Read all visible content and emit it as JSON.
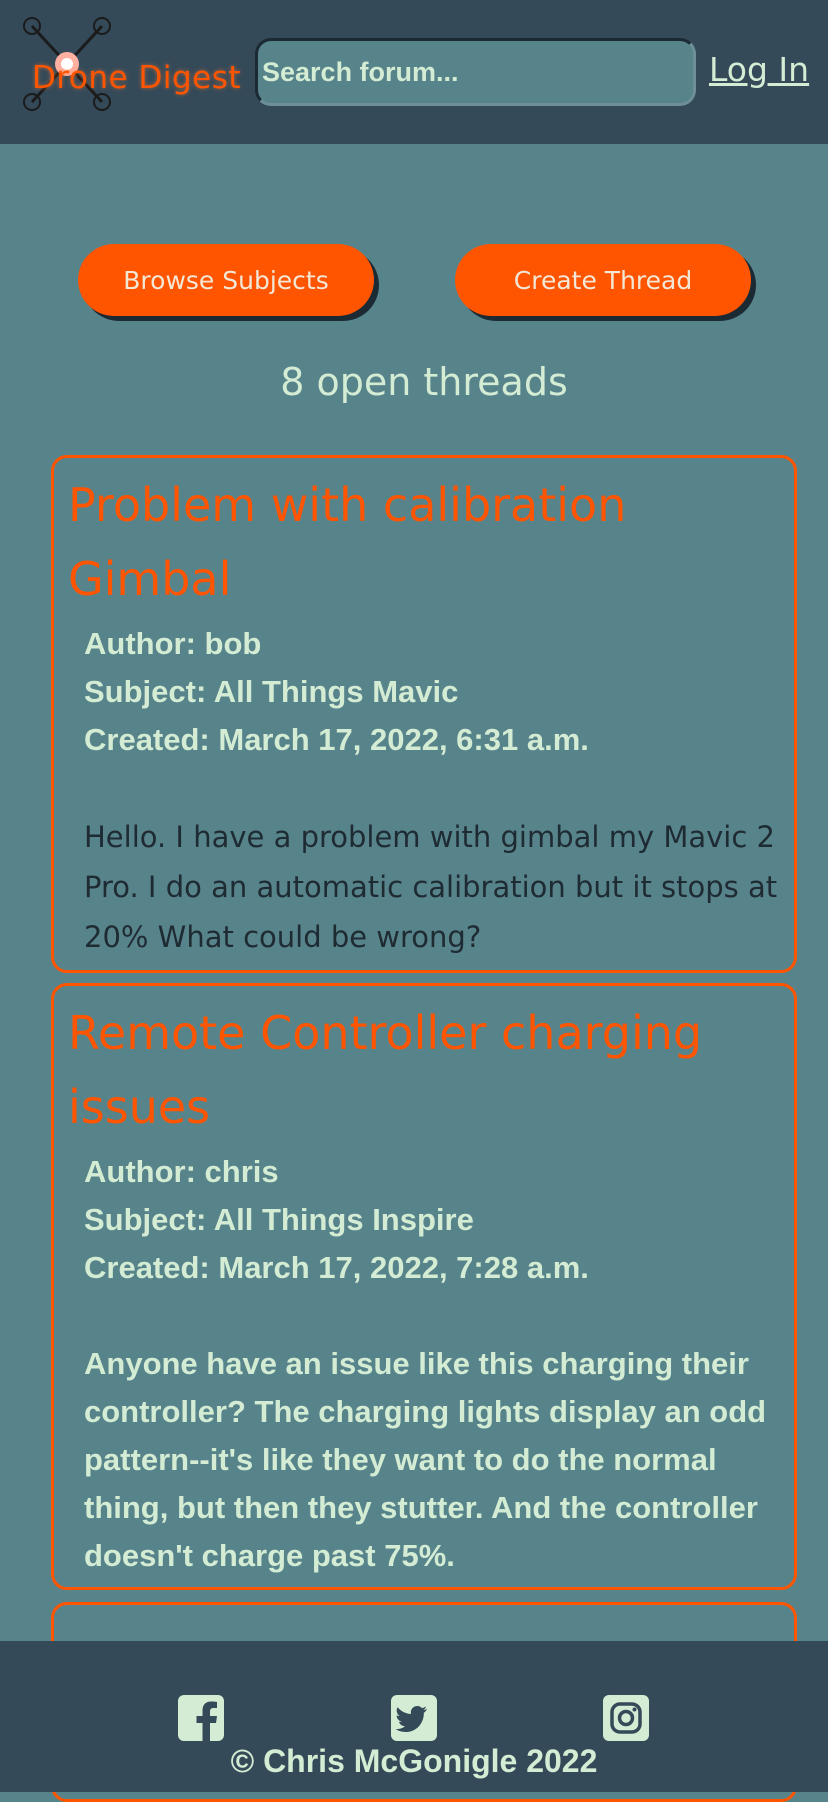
{
  "header": {
    "logo_text": "Drone Digest",
    "search_placeholder": "Search forum...",
    "login_label": "Log In"
  },
  "actions": {
    "browse_label": "Browse Subjects",
    "create_label": "Create Thread"
  },
  "thread_count_text": "8 open threads",
  "threads": [
    {
      "title": "Problem with calibration Gimbal",
      "author": "Author: bob",
      "subject": "Subject: All Things Mavic",
      "created": "Created: March 17, 2022, 6:31 a.m.",
      "body": "Hello. I have a problem with gimbal my Mavic 2 Pro. I do an automatic calibration but it stops at 20% What could be wrong?"
    },
    {
      "title": "Remote Controller charging issues",
      "author": "Author: chris",
      "subject": "Subject: All Things Inspire",
      "created": "Created: March 17, 2022, 7:28 a.m.",
      "body": "Anyone have an issue like this charging their controller? The charging lights display an odd pattern--it's like they want to do the normal thing, but then they stutter. And the controller doesn't charge past 75%."
    }
  ],
  "footer": {
    "icons": [
      "facebook-icon",
      "twitter-icon",
      "instagram-icon"
    ],
    "copyright": "© Chris McGonigle 2022"
  },
  "colors": {
    "header_bg": "#344a59",
    "page_bg": "#57838b",
    "accent": "#ff5500",
    "text_light": "#d3ecd3"
  }
}
